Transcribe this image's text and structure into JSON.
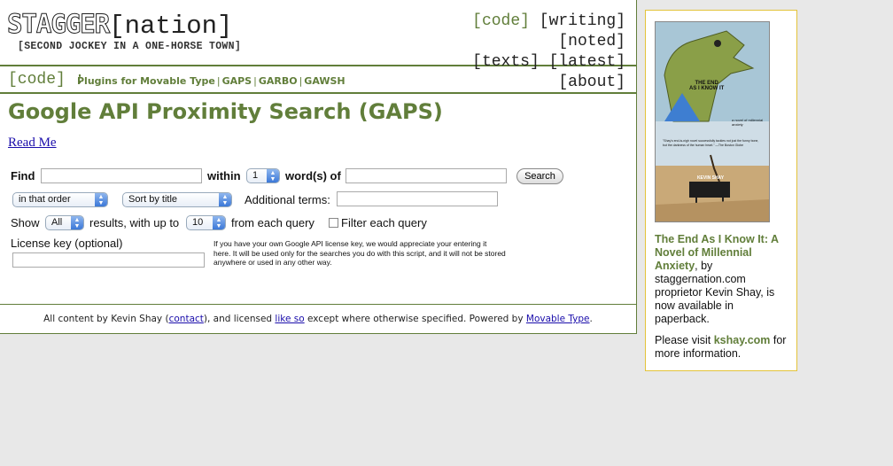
{
  "site": {
    "logo_main": "STAGGER",
    "logo_bracket": "[nation]",
    "tagline": "[SECOND JOCKEY IN A ONE-HORSE TOWN]"
  },
  "topnav": [
    {
      "label": "[code]",
      "active": true
    },
    {
      "label": "[writing]",
      "active": false
    },
    {
      "label": "[noted]",
      "active": false
    },
    {
      "label": "[texts]",
      "active": false
    },
    {
      "label": "[latest]",
      "active": false
    },
    {
      "label": "[about]",
      "active": false
    }
  ],
  "breadcrumb": {
    "section": "[code]",
    "colon": ":",
    "links": [
      "Plugins for Movable Type",
      "GAPS",
      "GARBO",
      "GAWSH"
    ]
  },
  "page": {
    "title": "Google API Proximity Search (GAPS)",
    "read_me": "Read Me"
  },
  "form": {
    "find_label": "Find",
    "within_label": "within",
    "within_value": "1",
    "words_of_label": "word(s) of",
    "search_button": "Search",
    "order_value": "in that order",
    "sort_value": "Sort by title",
    "additional_terms_label": "Additional terms:",
    "show_label": "Show",
    "show_value": "All",
    "results_label": "results, with up to",
    "per_query_value": "10",
    "from_each_label": "from each query",
    "filter_label": "Filter each query",
    "license_label": "License key (optional)",
    "license_note": "If you have your own Google API license key, we would appreciate your entering it here. It will be used only for the searches you do with this script, and it will not be stored anywhere or used in any other way."
  },
  "footer": {
    "prefix": "All content by Kevin Shay (",
    "contact": "contact",
    "middle": "), and licensed ",
    "like_so": "like so",
    "after": " except where otherwise specified. Powered by ",
    "movable_type": "Movable Type",
    "end": "."
  },
  "sidebar": {
    "book_title": "The End As I Know It: A Novel of Millennial Anxiety",
    "body": ", by staggernation.com proprietor Kevin Shay, is now available in paperback.",
    "visit": "Please visit ",
    "site_link": "kshay.com",
    "visit_end": " for more information.",
    "cover": {
      "title_line1": "THE END",
      "title_line2": "AS I KNOW IT",
      "subtitle": "a novel of millennial anxiety",
      "blurb": "\"Shay's end-is-nigh novel successfully tackles not just the funny bone, but the darkness of the human heart.\" —The Boston Globe",
      "author": "KEVIN SHAY"
    }
  },
  "colors": {
    "accent": "#617e3a",
    "sidebar_border": "#e3c33a",
    "link": "#1a0dab"
  }
}
